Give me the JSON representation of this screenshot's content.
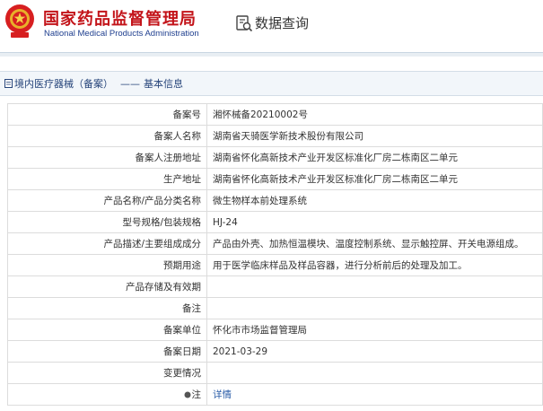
{
  "header": {
    "site_name_cn": "国家药品监督管理局",
    "site_name_en": "National Medical Products Administration",
    "emblem_icon": "national-emblem-icon",
    "query_icon": "document-search-icon",
    "query_title": "数据查询"
  },
  "breadcrumb": {
    "icon": "document-icon",
    "section": "境内医疗器械（备案）",
    "separator": "——",
    "page": "基本信息"
  },
  "record": {
    "rows": [
      {
        "label": "备案号",
        "value": "湘怀械备20210002号"
      },
      {
        "label": "备案人名称",
        "value": "湖南省天骑医学新技术股份有限公司"
      },
      {
        "label": "备案人注册地址",
        "value": "湖南省怀化高新技术产业开发区标准化厂房二栋南区二单元"
      },
      {
        "label": "生产地址",
        "value": "湖南省怀化高新技术产业开发区标准化厂房二栋南区二单元"
      },
      {
        "label": "产品名称/产品分类名称",
        "value": "微生物样本前处理系统"
      },
      {
        "label": "型号规格/包装规格",
        "value": "HJ-24"
      },
      {
        "label": "产品描述/主要组成成分",
        "value": "产品由外壳、加热恒温模块、温度控制系统、显示触控屏、开关电源组成。"
      },
      {
        "label": "预期用途",
        "value": "用于医学临床样品及样品容器，进行分析前后的处理及加工。"
      },
      {
        "label": "产品存储及有效期",
        "value": ""
      },
      {
        "label": "备注",
        "value": ""
      },
      {
        "label": "备案单位",
        "value": "怀化市市场监督管理局"
      },
      {
        "label": "备案日期",
        "value": "2021-03-29"
      },
      {
        "label": "变更情况",
        "value": ""
      },
      {
        "label": "注",
        "value": "详情",
        "is_link": true,
        "icon": "info-dot-icon"
      }
    ]
  },
  "colors": {
    "brand_red": "#c3141a",
    "brand_blue": "#1f3f8f",
    "link": "#2a5da8",
    "border": "#dcdcdc"
  }
}
